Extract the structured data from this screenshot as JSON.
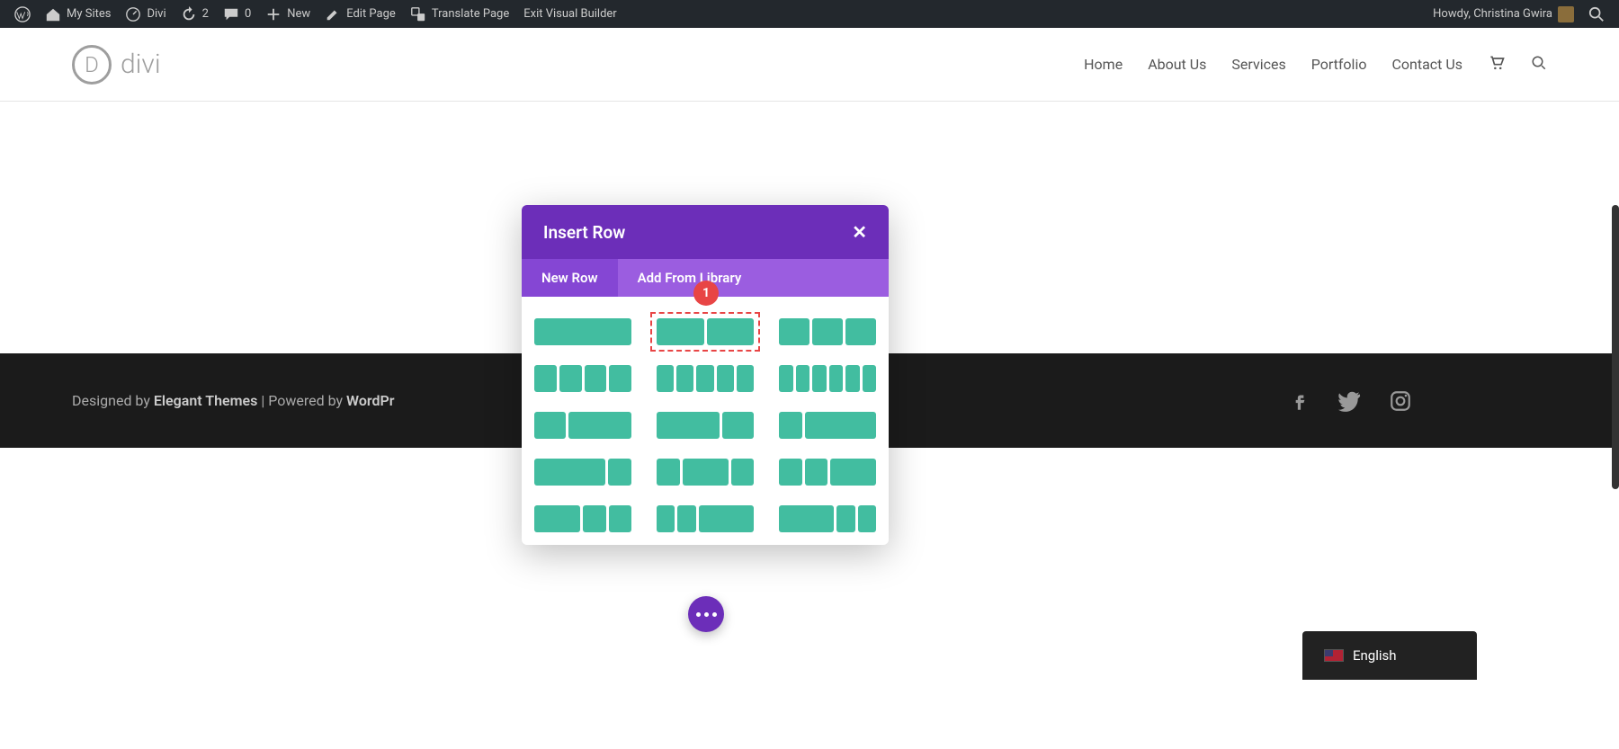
{
  "adminBar": {
    "mySites": "My Sites",
    "siteName": "Divi",
    "updates": "2",
    "comments": "0",
    "new": "New",
    "editPage": "Edit Page",
    "translatePage": "Translate Page",
    "exitBuilder": "Exit Visual Builder",
    "greeting": "Howdy, Christina Gwira"
  },
  "header": {
    "logoLetter": "D",
    "logoText": "divi"
  },
  "nav": {
    "items": [
      "Home",
      "About Us",
      "Services",
      "Portfolio",
      "Contact Us"
    ]
  },
  "footer": {
    "prefix": "Designed by ",
    "themes": "Elegant Themes",
    "mid": " | Powered by ",
    "wp": "WordPr"
  },
  "modal": {
    "title": "Insert Row",
    "tabs": [
      "New Row",
      "Add From Library"
    ]
  },
  "annotation": {
    "num": "1"
  },
  "lang": {
    "label": "English"
  },
  "layouts": [
    [
      1
    ],
    [
      1,
      1
    ],
    [
      1,
      1,
      1
    ],
    [
      1,
      1,
      1,
      1
    ],
    [
      1,
      1,
      1,
      1,
      1
    ],
    [
      1,
      1,
      1,
      1,
      1,
      1
    ],
    [
      1,
      2
    ],
    [
      2,
      1
    ],
    [
      1,
      3
    ],
    [
      3,
      1
    ],
    [
      1,
      2,
      1
    ],
    [
      1,
      1,
      2
    ],
    [
      2,
      1,
      1
    ],
    [
      1,
      1,
      3
    ],
    [
      3,
      1,
      1
    ]
  ]
}
